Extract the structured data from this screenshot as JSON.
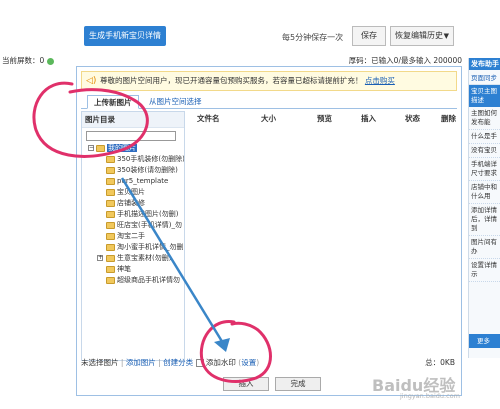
{
  "header": {
    "generate_button": "生成手机新宝贝详情",
    "autosave_note": "每5分钟保存一次",
    "save_button": "保存",
    "history_button": "恢复编辑历史"
  },
  "status": {
    "left_label": "当前屏数：0",
    "right_label": "厚码：已输入0/最多输入 200000"
  },
  "notice": {
    "text": "尊敬的图片空间用户，现已开通容量包预购买服务，若容量已超标请提前扩充！",
    "link": "点击购买"
  },
  "tabs": {
    "upload": "上传新图片",
    "from_space": "从图片空间选择"
  },
  "tree": {
    "title": "图片目录",
    "search_placeholder": "",
    "root": "我的图片",
    "items": [
      "350手机装修(勿删除)",
      "350装修(请勿删除)",
      "pur5_template",
      "宝贝图片",
      "店铺装修",
      "手机描述图片(勿删)",
      "旺店宝(手机详情)_勿",
      "淘宝二手",
      "淘小蜜手机详情_勿删",
      "生意宝素材(勿删)",
      "神笔",
      "超级商品手机详情勿"
    ]
  },
  "table": {
    "columns": [
      "文件名",
      "大小",
      "预览",
      "插入",
      "状态",
      "删除"
    ]
  },
  "bottom": {
    "unselected": "未选择图片",
    "add_link": "添加图片",
    "create_link": "创建分类",
    "watermark_label": "添加水印",
    "settings_link": "设置",
    "size_info": "总：0KB"
  },
  "actions": {
    "insert": "插入",
    "done": "完成"
  },
  "help": {
    "header": "发布助手",
    "sub": "页面同步",
    "active": "宝贝主图描述",
    "questions": [
      "主图如何发布能",
      "什么是手",
      "没有宝贝",
      "手机端详尺寸要求",
      "店铺中和什么用",
      "添加详情后，详情到",
      "图片间有办",
      "设置详情示"
    ],
    "more": "更多"
  },
  "watermark": {
    "main": "Baidu经验",
    "sub": "jingyan.baidu.com"
  },
  "colors": {
    "primary": "#2d80d2",
    "annotation": "#e0306a",
    "arrow": "#3a86c8"
  }
}
